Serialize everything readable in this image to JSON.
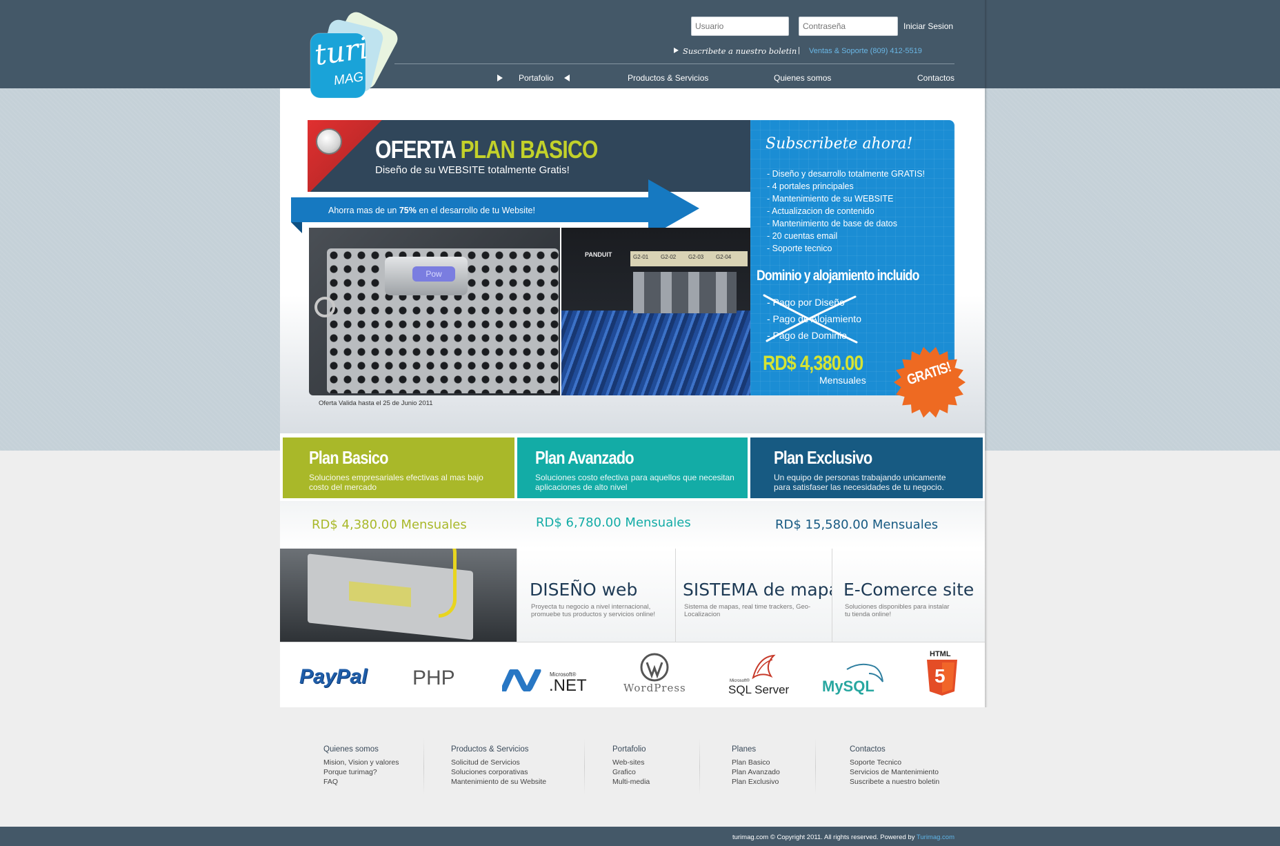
{
  "header": {
    "login": {
      "user_placeholder": "Usuario",
      "pass_placeholder": "Contraseña",
      "login_label": "Iniciar Sesion"
    },
    "newsletter_label": "Suscribete a nuestro boletin",
    "separator": "|",
    "support_text": "Ventas & Soporte (809) 412-5519",
    "nav": [
      "Portafolio",
      "Productos & Servicios",
      "Quienes somos",
      "Contactos"
    ],
    "logo": {
      "line1": "turi",
      "line2": "MAG"
    }
  },
  "hero": {
    "title_part1": "OFERTA",
    "title_part2": "PLAN BASICO",
    "subtitle": "Diseño de su WEBSITE totalmente Gratis!",
    "ribbon_prefix": "Ahorra mas de un ",
    "ribbon_bold": "75%",
    "ribbon_suffix": " en el desarrollo de tu Website!",
    "validity": "Oferta Valida hasta el 25 de Junio 2011",
    "panel": {
      "heading": "Subscribete ahora!",
      "bullets": [
        "- Diseño y desarrollo totalmente GRATIS!",
        "- 4 portales principales",
        "- Mantenimiento de su WEBSITE",
        "- Actualizacion de contenido",
        "- Mantenimiento de base de datos",
        "- 20 cuentas email",
        "- Soporte tecnico"
      ],
      "subheading": "Dominio y alojamiento incluido",
      "crossed": [
        "- Pago por Diseño",
        "- Pago de Alojamiento",
        "- Pago de Dominio"
      ],
      "price": "RD$ 4,380.00",
      "price_period": "Mensuales",
      "badge": "GRATIS!"
    },
    "photo_labels": {
      "rack_panel": "Pow",
      "switch_brand": "PANDUIT",
      "ports": [
        "G2-01",
        "G2-02",
        "G2-03",
        "G2-04"
      ]
    }
  },
  "plans": [
    {
      "name": "Plan Basico",
      "desc": "Soluciones empresariales efectivas al mas bajo costo del mercado",
      "price": "RD$ 4,380.00 Mensuales",
      "color": "#a9b829"
    },
    {
      "name": "Plan Avanzado",
      "desc": "Soluciones costo efectiva para aquellos que necesitan aplicaciones de alto nivel",
      "price": "RD$ 6,780.00 Mensuales",
      "color": "#13aca6"
    },
    {
      "name": "Plan Exclusivo",
      "desc": "Un equipo de personas trabajando unicamente para satisfaser las necesidades de tu negocio.",
      "price": "RD$ 15,580.00 Mensuales",
      "color": "#175a82"
    }
  ],
  "services": [
    {
      "title": "DISEÑO web",
      "desc": "Proyecta tu negocio a nivel internacional, promuebe tus productos y servicios online!"
    },
    {
      "title": "SISTEMA de mapa",
      "desc": "Sistema de mapas, real time trackers, Geo-Localizacion"
    },
    {
      "title": "E-Comerce site",
      "desc": "Soluciones disponibles para instalar tu tienda online!"
    }
  ],
  "tech_logos": {
    "paypal": "PayPal",
    "php": "PHP",
    "net_small": "Microsoft®",
    "net": ".NET",
    "wordpress": "WordPress",
    "sql_small": "Microsoft®",
    "sql": "SQL Server",
    "mysql": "MySQL",
    "html5": "HTML",
    "html5_num": "5"
  },
  "footer": {
    "columns": [
      {
        "heading": "Quienes somos",
        "items": [
          "Mision, Vision y valores",
          "Porque turimag?",
          "FAQ"
        ]
      },
      {
        "heading": "Productos & Servicios",
        "items": [
          "Solicitud de Servicios",
          "Soluciones corporativas",
          "Mantenimiento de su Website"
        ]
      },
      {
        "heading": "Portafolio",
        "items": [
          "Web-sites",
          "Grafico",
          "Multi-media"
        ]
      },
      {
        "heading": "Planes",
        "items": [
          "Plan Basico",
          "Plan Avanzado",
          "Plan Exclusivo"
        ]
      },
      {
        "heading": "Contactos",
        "items": [
          "Soporte Tecnico",
          "Servicios de Mantenimiento",
          "Suscribete a nuestro boletin"
        ]
      }
    ],
    "copyright": "turimag.com © Copyright 2011. All rights reserved. Powered by ",
    "powered_link": "Turimag.com"
  }
}
